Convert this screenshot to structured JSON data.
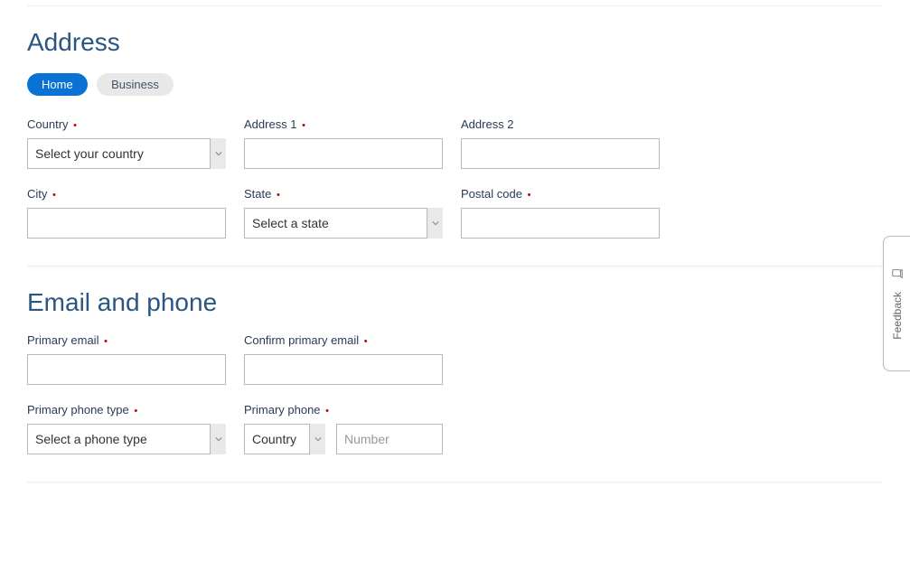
{
  "address": {
    "title": "Address",
    "tabs": {
      "home": "Home",
      "business": "Business"
    },
    "fields": {
      "country": {
        "label": "Country",
        "selected": "Select your country"
      },
      "address1": {
        "label": "Address 1"
      },
      "address2": {
        "label": "Address 2"
      },
      "city": {
        "label": "City"
      },
      "state": {
        "label": "State",
        "selected": "Select a state"
      },
      "postal": {
        "label": "Postal code"
      }
    }
  },
  "emailphone": {
    "title": "Email and phone",
    "fields": {
      "primary_email": {
        "label": "Primary email"
      },
      "confirm_email": {
        "label": "Confirm primary email"
      },
      "phone_type": {
        "label": "Primary phone type",
        "selected": "Select a phone type"
      },
      "primary_phone": {
        "label": "Primary phone",
        "country_selected": "Country",
        "number_placeholder": "Number"
      }
    }
  },
  "feedback_label": "Feedback"
}
